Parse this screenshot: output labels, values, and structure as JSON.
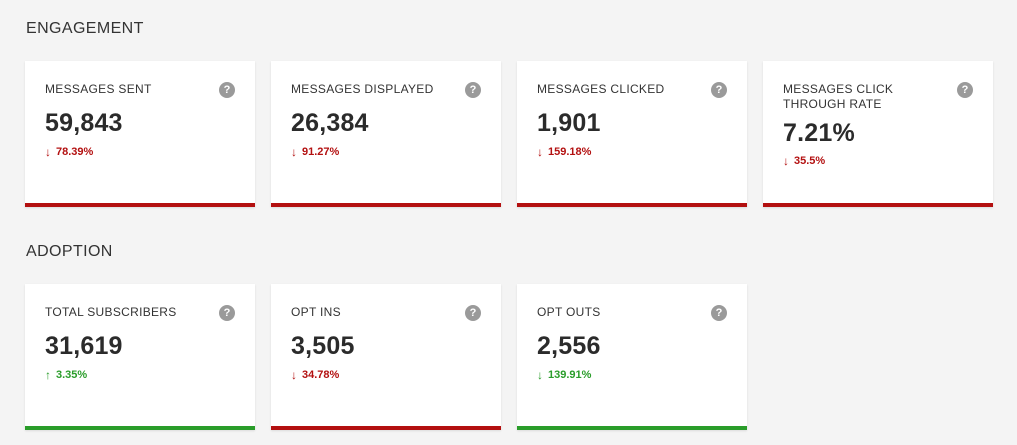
{
  "engagement": {
    "title": "ENGAGEMENT",
    "cards": [
      {
        "label": "MESSAGES SENT",
        "value": "59,843",
        "change": "78.39%",
        "direction": "down",
        "status_color": "#b31010"
      },
      {
        "label": "MESSAGES DISPLAYED",
        "value": "26,384",
        "change": "91.27%",
        "direction": "down",
        "status_color": "#b31010"
      },
      {
        "label": "MESSAGES CLICKED",
        "value": "1,901",
        "change": "159.18%",
        "direction": "down",
        "status_color": "#b31010"
      },
      {
        "label": "MESSAGES CLICK THROUGH RATE",
        "value": "7.21%",
        "change": "35.5%",
        "direction": "down",
        "status_color": "#b31010"
      }
    ]
  },
  "adoption": {
    "title": "ADOPTION",
    "cards": [
      {
        "label": "TOTAL SUBSCRIBERS",
        "value": "31,619",
        "change": "3.35%",
        "direction": "up",
        "status_color": "#2a9d2a"
      },
      {
        "label": "OPT INS",
        "value": "3,505",
        "change": "34.78%",
        "direction": "down",
        "status_color": "#b31010"
      },
      {
        "label": "OPT OUTS",
        "value": "2,556",
        "change": "139.91%",
        "direction": "down",
        "status_color": "#2a9d2a"
      }
    ]
  },
  "icons": {
    "help": "?",
    "arrow_down": "↓",
    "arrow_up": "↑"
  },
  "colors": {
    "negative": "#b31010",
    "positive": "#2a9d2a",
    "help_icon": "#9a9a9a"
  }
}
